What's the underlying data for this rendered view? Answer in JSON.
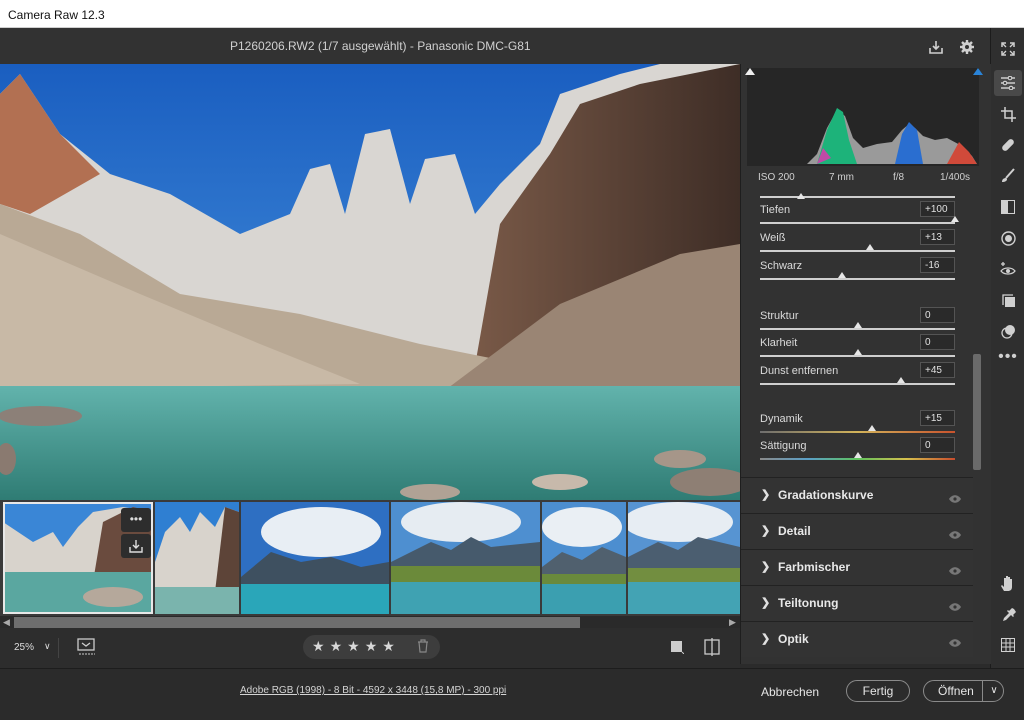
{
  "window": {
    "title": "Camera Raw 12.3"
  },
  "topbar": {
    "file_title": "P1260206.RW2 (1/7 ausgewählt) - Panasonic DMC-G81"
  },
  "histogram": {
    "camera_info": {
      "iso": "ISO 200",
      "focal": "7 mm",
      "aperture": "f/8",
      "shutter": "1/400s"
    }
  },
  "sliders": [
    {
      "label": "Tiefen",
      "value": "+100",
      "position": 1.0
    },
    {
      "label": "Weiß",
      "value": "+13",
      "position": 0.565
    },
    {
      "label": "Schwarz",
      "value": "-16",
      "position": 0.42
    },
    {
      "label": "Struktur",
      "value": "0",
      "position": 0.5
    },
    {
      "label": "Klarheit",
      "value": "0",
      "position": 0.5
    },
    {
      "label": "Dunst entfernen",
      "value": "+45",
      "position": 0.725
    },
    {
      "label": "Dynamik",
      "value": "+15",
      "position": 0.575
    },
    {
      "label": "Sättigung",
      "value": "0",
      "position": 0.5
    }
  ],
  "sections": [
    {
      "label": "Gradationskurve"
    },
    {
      "label": "Detail"
    },
    {
      "label": "Farbmischer"
    },
    {
      "label": "Teiltonung"
    },
    {
      "label": "Optik"
    }
  ],
  "bottom": {
    "zoom": "25%",
    "rating_stars": 5
  },
  "footer": {
    "color_info": "Adobe RGB (1998) - 8 Bit - 4592 x 3448 (15,8 MP) - 300 ppi",
    "cancel": "Abbrechen",
    "done": "Fertig",
    "open": "Öffnen"
  },
  "tools": [
    "edit-sliders-icon",
    "crop-icon",
    "healing-icon",
    "brush-icon",
    "gradient-icon",
    "radial-filter-icon",
    "red-eye-icon",
    "snapshots-icon",
    "presets-icon",
    "more-icon"
  ],
  "colors": {
    "accent_blue": "#2a84d8",
    "panel": "#323232",
    "background": "#2b2b2b"
  }
}
